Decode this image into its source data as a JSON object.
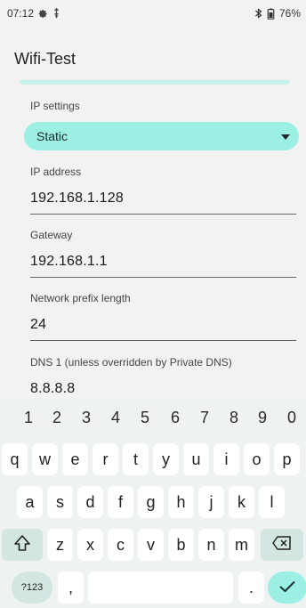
{
  "status_bar": {
    "time": "07:12",
    "battery": "76%",
    "icons": [
      "gear-icon",
      "vpn-key-icon",
      "bluetooth-icon",
      "battery-icon"
    ]
  },
  "app": {
    "title": "Wifi-Test"
  },
  "form": {
    "ip_settings": {
      "label": "IP settings",
      "value": "Static"
    },
    "ip_address": {
      "label": "IP address",
      "value": "192.168.1.128"
    },
    "gateway": {
      "label": "Gateway",
      "value": "192.168.1.1"
    },
    "prefix": {
      "label": "Network prefix length",
      "value": "24"
    },
    "dns1": {
      "label": "DNS 1 (unless overridden by Private DNS)",
      "value": "8.8.8.8"
    }
  },
  "keyboard": {
    "numbers": [
      "1",
      "2",
      "3",
      "4",
      "5",
      "6",
      "7",
      "8",
      "9",
      "0"
    ],
    "row1": [
      "q",
      "w",
      "e",
      "r",
      "t",
      "y",
      "u",
      "i",
      "o",
      "p"
    ],
    "row2": [
      "a",
      "s",
      "d",
      "f",
      "g",
      "h",
      "j",
      "k",
      "l"
    ],
    "row3": [
      "z",
      "x",
      "c",
      "v",
      "b",
      "n",
      "m"
    ],
    "symbols_label": "?123",
    "comma": ",",
    "period": "."
  },
  "colors": {
    "accent": "#9cefe3",
    "keyboard_bg": "#eef3f2",
    "special_key": "#d4e6e2"
  }
}
